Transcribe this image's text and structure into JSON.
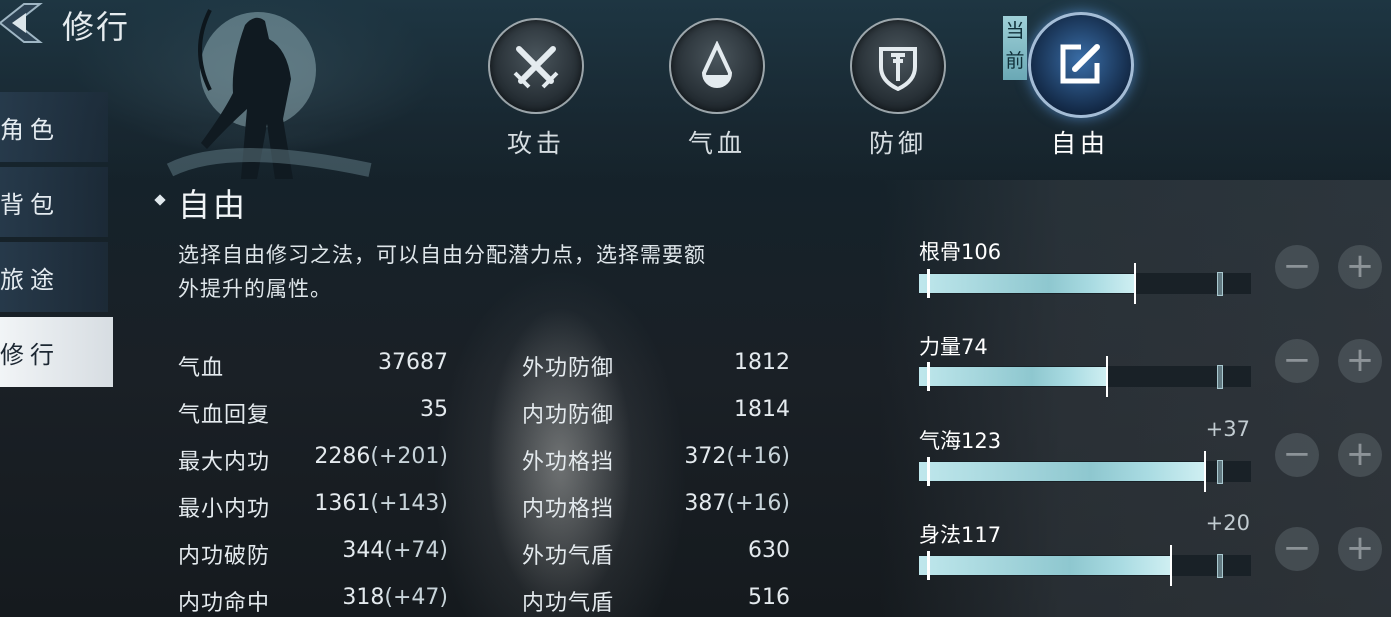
{
  "header": {
    "title": "修行"
  },
  "nav": [
    {
      "label": "角色"
    },
    {
      "label": "背包"
    },
    {
      "label": "旅途"
    },
    {
      "label": "修行",
      "active": true
    }
  ],
  "tabs": [
    {
      "label": "攻击",
      "icon": "crossed-swords-icon"
    },
    {
      "label": "气血",
      "icon": "drop-icon"
    },
    {
      "label": "防御",
      "icon": "shield-icon"
    },
    {
      "label": "自由",
      "icon": "edit-icon",
      "current": true
    }
  ],
  "current_tag": "当前",
  "section": {
    "title": "自由",
    "description": "选择自由修习之法，可以自由分配潜力点，选择需要额外提升的属性。",
    "description_line1": "选择自由修习之法，可以自由分配潜力点，选择需要额",
    "description_line2": "外提升的属性。"
  },
  "stats_left": [
    {
      "label": "气血",
      "value": "37687",
      "bonus": ""
    },
    {
      "label": "气血回复",
      "value": "35",
      "bonus": ""
    },
    {
      "label": "最大内功",
      "value": "2286",
      "bonus": "(+201)"
    },
    {
      "label": "最小内功",
      "value": "1361",
      "bonus": "(+143)"
    },
    {
      "label": "内功破防",
      "value": "344",
      "bonus": "(+74)"
    },
    {
      "label": "内功命中",
      "value": "318",
      "bonus": "(+47)"
    }
  ],
  "stats_right": [
    {
      "label": "外功防御",
      "value": "1812",
      "bonus": ""
    },
    {
      "label": "内功防御",
      "value": "1814",
      "bonus": ""
    },
    {
      "label": "外功格挡",
      "value": "372",
      "bonus": "(+16)"
    },
    {
      "label": "内功格挡",
      "value": "387",
      "bonus": "(+16)"
    },
    {
      "label": "外功气盾",
      "value": "630",
      "bonus": ""
    },
    {
      "label": "内功气盾",
      "value": "516",
      "bonus": ""
    }
  ],
  "attributes": [
    {
      "label": "根骨106",
      "bonus": "",
      "fill": 0.65
    },
    {
      "label": "力量74",
      "bonus": "",
      "fill": 0.565
    },
    {
      "label": "气海123",
      "bonus": "+37",
      "fill": 0.86
    },
    {
      "label": "身法117",
      "bonus": "+20",
      "fill": 0.76
    }
  ],
  "buttons": {
    "minus": "−",
    "plus": "+"
  },
  "colors": {
    "accent": "#8ec7cf",
    "current_tab": "#3a6ea8"
  }
}
